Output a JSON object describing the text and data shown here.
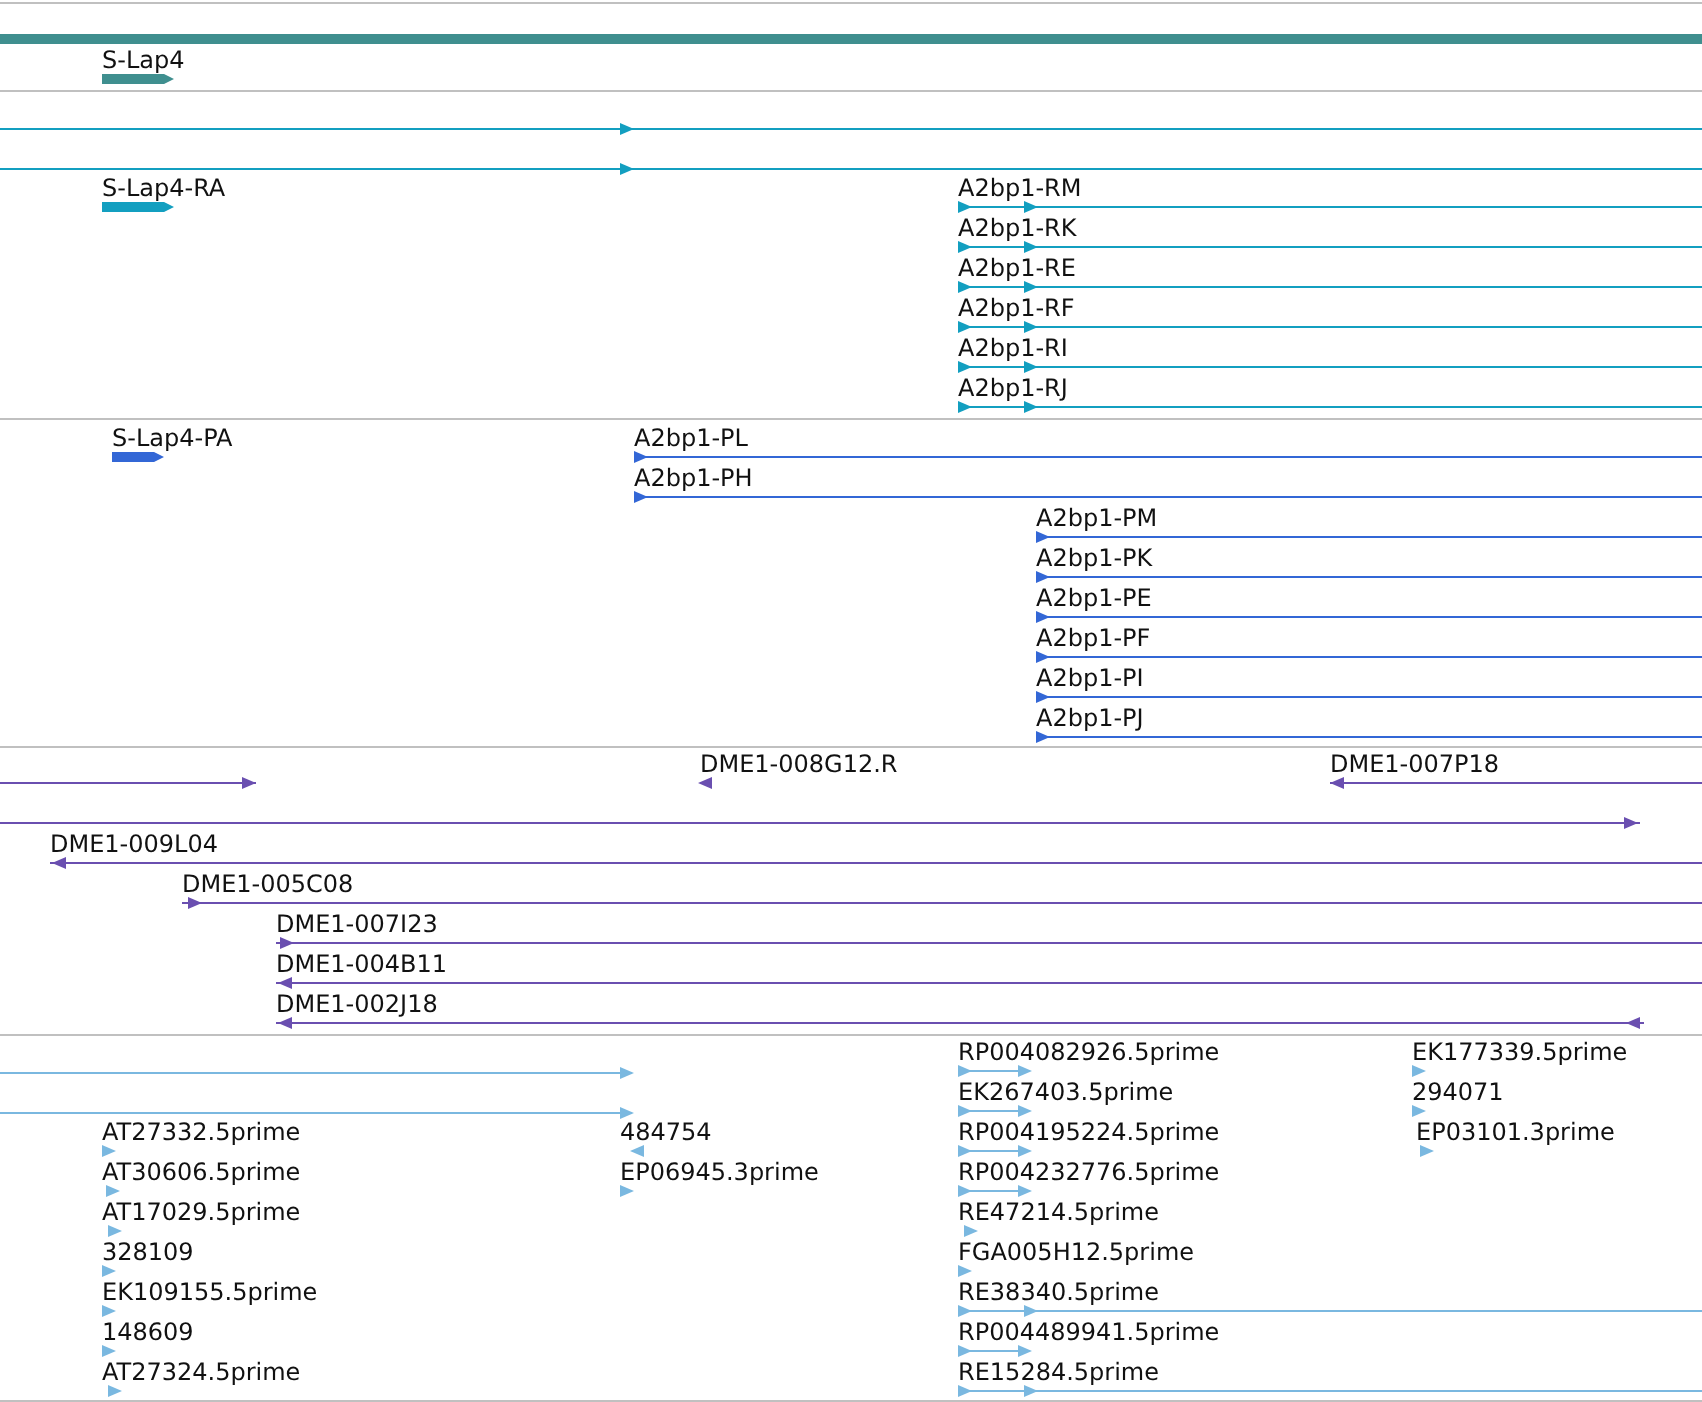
{
  "tracks": [
    {
      "color": "#3f8f8f",
      "features": [
        {
          "kind": "span"
        },
        {
          "kind": "bar",
          "label": "S-Lap4",
          "reverse": false
        }
      ]
    },
    {
      "color": "#139fc0",
      "features": [
        {
          "kind": "arrow",
          "reverse": false
        },
        {
          "kind": "arrow",
          "reverse": false
        },
        {
          "kind": "bar",
          "label": "S-Lap4-RA",
          "reverse": false
        },
        {
          "kind": "arrow",
          "label": "A2bp1-RM",
          "reverse": false
        },
        {
          "kind": "arrow",
          "label": "A2bp1-RK",
          "reverse": false
        },
        {
          "kind": "arrow",
          "label": "A2bp1-RE",
          "reverse": false
        },
        {
          "kind": "arrow",
          "label": "A2bp1-RF",
          "reverse": false
        },
        {
          "kind": "arrow",
          "label": "A2bp1-RI",
          "reverse": false
        },
        {
          "kind": "arrow",
          "label": "A2bp1-RJ",
          "reverse": false
        }
      ]
    },
    {
      "color": "#3367d6",
      "features": [
        {
          "kind": "bar",
          "label": "S-Lap4-PA",
          "reverse": false
        },
        {
          "kind": "arrow",
          "label": "A2bp1-PL",
          "reverse": false
        },
        {
          "kind": "arrow",
          "label": "A2bp1-PH",
          "reverse": false
        },
        {
          "kind": "arrow",
          "label": "A2bp1-PM",
          "reverse": false
        },
        {
          "kind": "arrow",
          "label": "A2bp1-PK",
          "reverse": false
        },
        {
          "kind": "arrow",
          "label": "A2bp1-PE",
          "reverse": false
        },
        {
          "kind": "arrow",
          "label": "A2bp1-PF",
          "reverse": false
        },
        {
          "kind": "arrow",
          "label": "A2bp1-PI",
          "reverse": false
        },
        {
          "kind": "arrow",
          "label": "A2bp1-PJ",
          "reverse": false
        }
      ]
    },
    {
      "color": "#6a4fb0",
      "features": [
        {
          "kind": "arrow",
          "reverse": false
        },
        {
          "kind": "arrow",
          "label": "DME1-008G12.R",
          "reverse": true
        },
        {
          "kind": "arrow",
          "label": "DME1-007P18",
          "reverse": true
        },
        {
          "kind": "arrow",
          "reverse": false
        },
        {
          "kind": "arrow",
          "label": "DME1-009L04",
          "reverse": true
        },
        {
          "kind": "arrow",
          "label": "DME1-005C08",
          "reverse": false
        },
        {
          "kind": "arrow",
          "label": "DME1-007I23",
          "reverse": false
        },
        {
          "kind": "arrow",
          "label": "DME1-004B11",
          "reverse": true
        },
        {
          "kind": "arrow",
          "label": "DME1-002J18",
          "reverse": true
        }
      ]
    },
    {
      "color": "#7ab8e0",
      "features": [
        {
          "kind": "arrow",
          "reverse": false
        },
        {
          "kind": "arrow",
          "reverse": false
        },
        {
          "kind": "arrow",
          "label": "AT27332.5prime",
          "reverse": false
        },
        {
          "kind": "arrow",
          "label": "AT30606.5prime",
          "reverse": false
        },
        {
          "kind": "arrow",
          "label": "AT17029.5prime",
          "reverse": false
        },
        {
          "kind": "arrow",
          "label": "328109",
          "reverse": false
        },
        {
          "kind": "arrow",
          "label": "EK109155.5prime",
          "reverse": false
        },
        {
          "kind": "arrow",
          "label": "148609",
          "reverse": false
        },
        {
          "kind": "arrow",
          "label": "AT27324.5prime",
          "reverse": false
        },
        {
          "kind": "arrow",
          "label": "484754",
          "reverse": true
        },
        {
          "kind": "arrow",
          "label": "EP06945.3prime",
          "reverse": false
        },
        {
          "kind": "arrow",
          "label": "RP004082926.5prime",
          "reverse": false
        },
        {
          "kind": "arrow",
          "label": "EK267403.5prime",
          "reverse": false
        },
        {
          "kind": "arrow",
          "label": "RP004195224.5prime",
          "reverse": false
        },
        {
          "kind": "arrow",
          "label": "RP004232776.5prime",
          "reverse": false
        },
        {
          "kind": "arrow",
          "label": "RE47214.5prime",
          "reverse": false
        },
        {
          "kind": "arrow",
          "label": "FGA005H12.5prime",
          "reverse": false
        },
        {
          "kind": "arrow",
          "label": "RE38340.5prime",
          "reverse": false
        },
        {
          "kind": "arrow",
          "label": "RP004489941.5prime",
          "reverse": false
        },
        {
          "kind": "arrow",
          "label": "RE15284.5prime",
          "reverse": false
        },
        {
          "kind": "arrow",
          "label": "EK177339.5prime",
          "reverse": false
        },
        {
          "kind": "arrow",
          "label": "294071",
          "reverse": false
        },
        {
          "kind": "arrow",
          "label": "EP03101.3prime",
          "reverse": false
        }
      ]
    }
  ]
}
